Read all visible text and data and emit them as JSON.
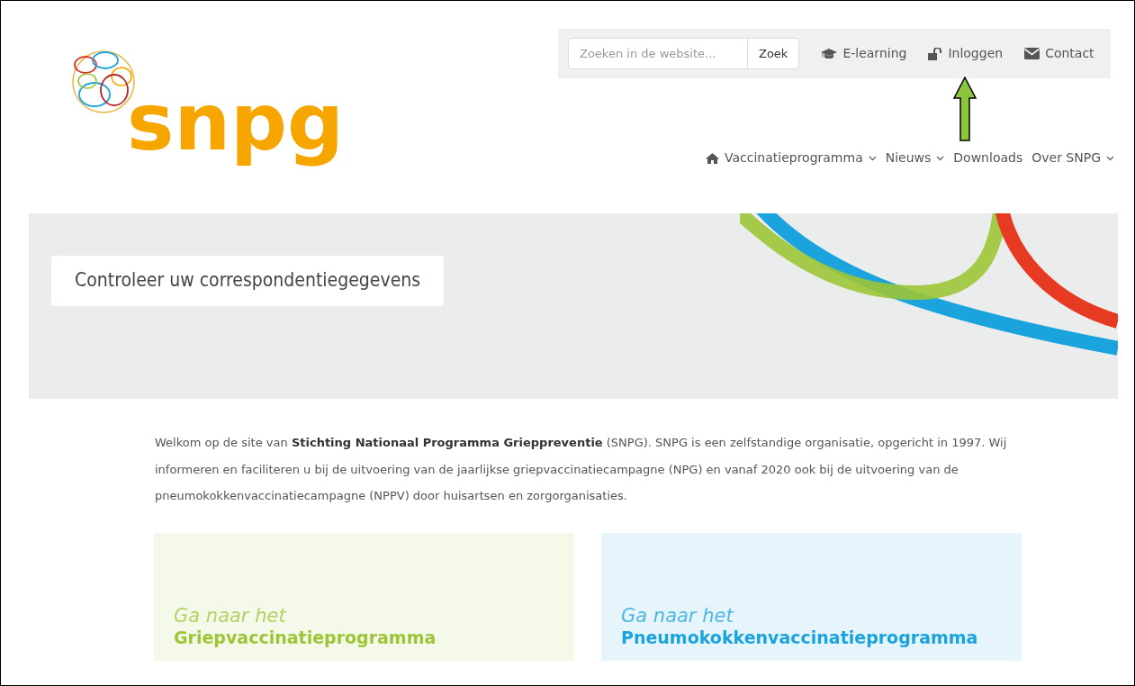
{
  "search": {
    "placeholder": "Zoeken in de website...",
    "button": "Zoek"
  },
  "top_links": [
    {
      "label": "E-learning"
    },
    {
      "label": "Inloggen"
    },
    {
      "label": "Contact"
    }
  ],
  "logo": {
    "text": "snpg"
  },
  "nav": [
    {
      "label": "Vaccinatieprogramma",
      "dropdown": true
    },
    {
      "label": "Nieuws",
      "dropdown": true
    },
    {
      "label": "Downloads",
      "dropdown": false
    },
    {
      "label": "Over SNPG",
      "dropdown": true
    }
  ],
  "hero": {
    "title": "Controleer uw correspondentiegegevens"
  },
  "intro": "Welkom op de site van **Stichting Nationaal Programma Grieppreventie** (SNPG). SNPG is een zelfstandige organisatie, opgericht in 1997. Wij informeren en faciliteren u bij de uitvoering van de jaarlijkse griepvaccinatiecampagne (NPG) en vanaf 2020 ook bij de uitvoering van de pneumokokkenvaccinatiecampagne (NPPV) door huisartsen en zorgorganisaties.",
  "cards": [
    {
      "kicker": "Ga naar het",
      "title": "Griepvaccinatieprogramma",
      "color": "#9dc537"
    },
    {
      "kicker": "Ga naar het",
      "title": "Pneumokokkenvaccinatieprogramma",
      "color": "#1ba3dd"
    }
  ]
}
